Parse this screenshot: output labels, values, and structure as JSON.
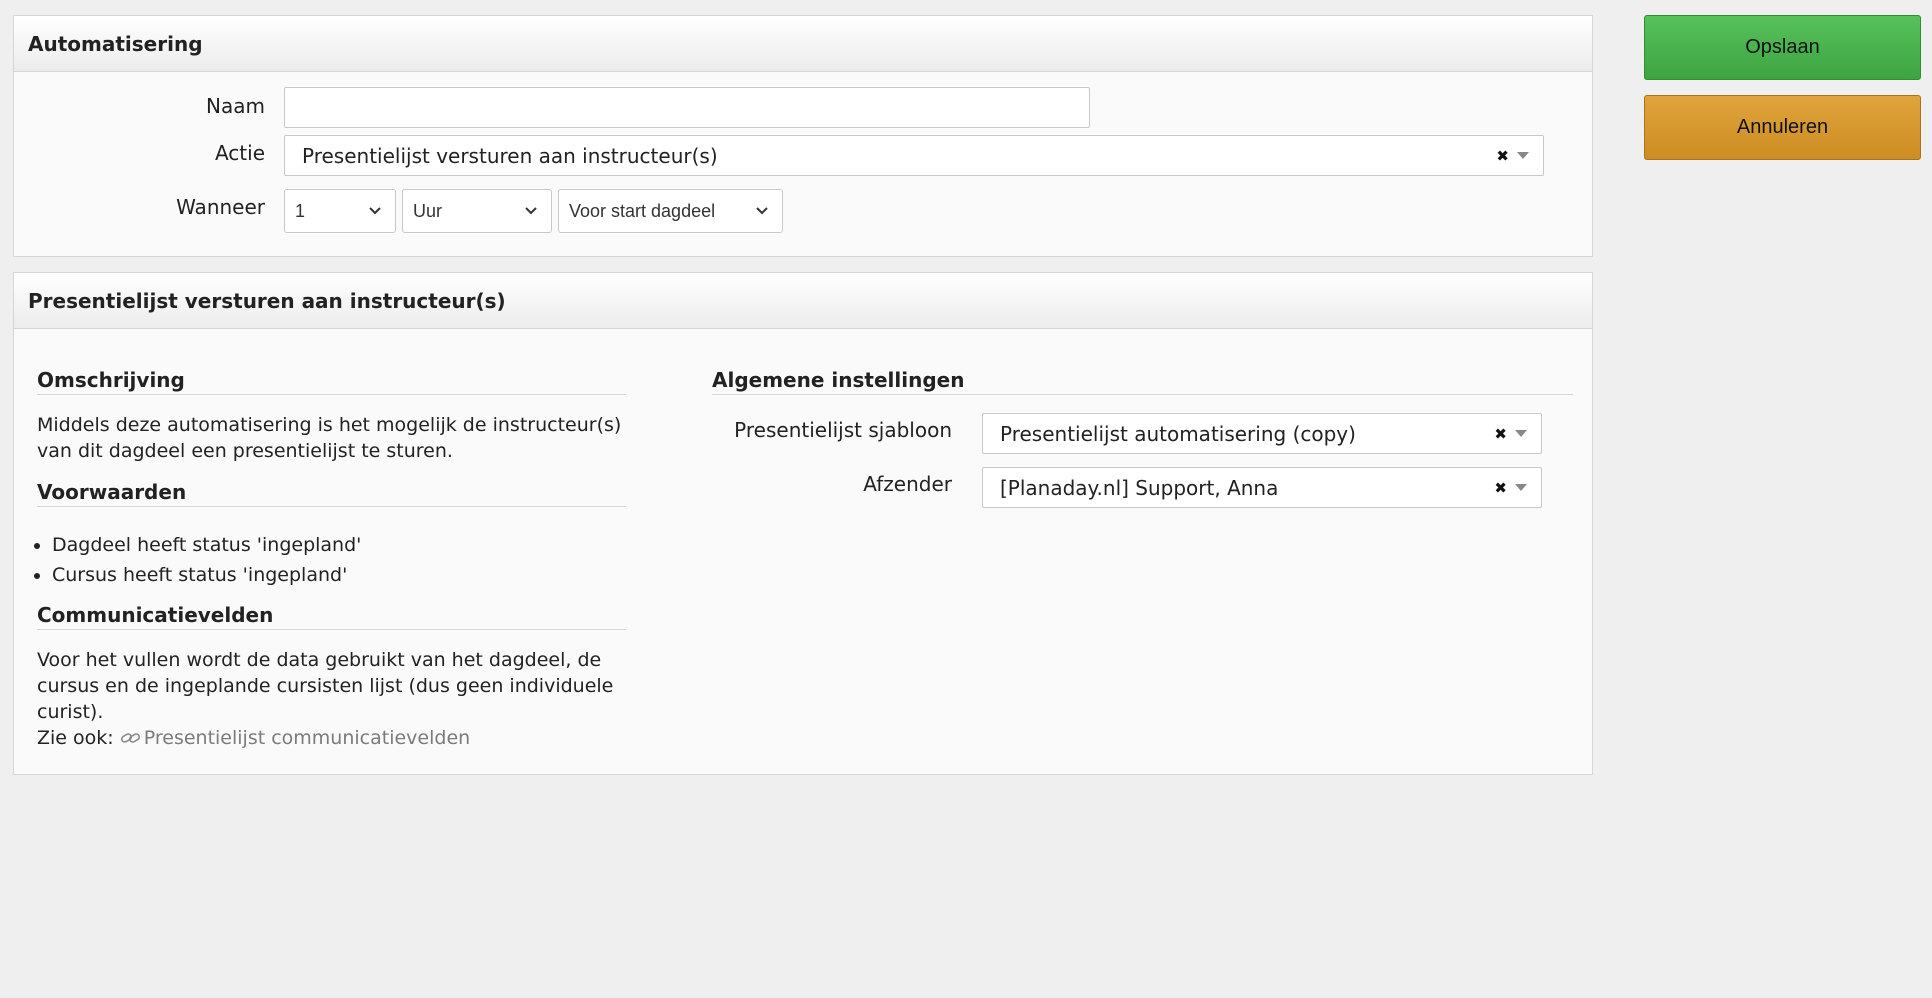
{
  "automation_panel": {
    "title": "Automatisering",
    "name": {
      "label": "Naam",
      "value": "",
      "placeholder": ""
    },
    "action": {
      "label": "Actie",
      "selected": "Presentielijst versturen aan instructeur(s)"
    },
    "when": {
      "label": "Wanneer",
      "amount": "1",
      "unit": "Uur",
      "moment": "Voor start dagdeel"
    }
  },
  "detail_panel": {
    "title": "Presentielijst versturen aan instructeur(s)",
    "description": {
      "title": "Omschrijving",
      "text": "Middels deze automatisering is het mogelijk de instructeur(s) van dit dagdeel een presentielijst te sturen."
    },
    "conditions": {
      "title": "Voorwaarden",
      "items": [
        "Dagdeel heeft status 'ingepland'",
        "Cursus heeft status 'ingepland'"
      ]
    },
    "communication_fields": {
      "title": "Communicatievelden",
      "text": "Voor het vullen wordt de data gebruikt van het dagdeel, de cursus en de ingeplande cursisten lijst (dus geen individuele curist).",
      "see_also_label": "Zie ook:",
      "link_text": "Presentielijst communicatievelden"
    },
    "general_settings": {
      "title": "Algemene instellingen",
      "template": {
        "label": "Presentielijst sjabloon",
        "selected": "Presentielijst automatisering (copy)"
      },
      "sender": {
        "label": "Afzender",
        "selected": "[Planaday.nl] Support, Anna"
      }
    }
  },
  "buttons": {
    "save": "Opslaan",
    "cancel": "Annuleren"
  },
  "colors": {
    "save_button": "#4cb74f",
    "cancel_button": "#d6972c",
    "link": "#7b7b7b",
    "background": "#efefef"
  },
  "icons": {
    "clear": "close-icon",
    "dropdown": "chevron-down-icon",
    "link": "link-icon"
  }
}
